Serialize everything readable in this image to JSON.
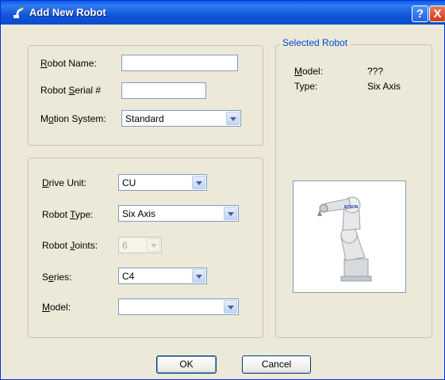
{
  "window": {
    "title": "Add New Robot",
    "help_label": "?",
    "close_label": "X"
  },
  "identity": {
    "robot_name_label": "Robot Name:",
    "robot_name_value": "",
    "robot_serial_label": "Robot Serial #",
    "robot_serial_value": "",
    "motion_system_label": "Motion System:",
    "motion_system_value": "Standard"
  },
  "config": {
    "drive_unit_label": "Drive Unit:",
    "drive_unit_value": "CU",
    "robot_type_label": "Robot Type:",
    "robot_type_value": "Six Axis",
    "robot_joints_label": "Robot Joints:",
    "robot_joints_value": "6",
    "series_label": "Series:",
    "series_value": "C4",
    "model_label": "Model:",
    "model_value": ""
  },
  "selected_robot": {
    "group_title": "Selected Robot",
    "model_label": "Model:",
    "model_value": "???",
    "type_label": "Type:",
    "type_value": "Six Axis",
    "image_icon": "robot-arm-image",
    "brand_text": "EPSON"
  },
  "buttons": {
    "ok_label": "OK",
    "cancel_label": "Cancel"
  },
  "colors": {
    "titlebar": "#0a5ae6",
    "dialog_bg": "#ece9d8",
    "group_title": "#0046d5"
  }
}
